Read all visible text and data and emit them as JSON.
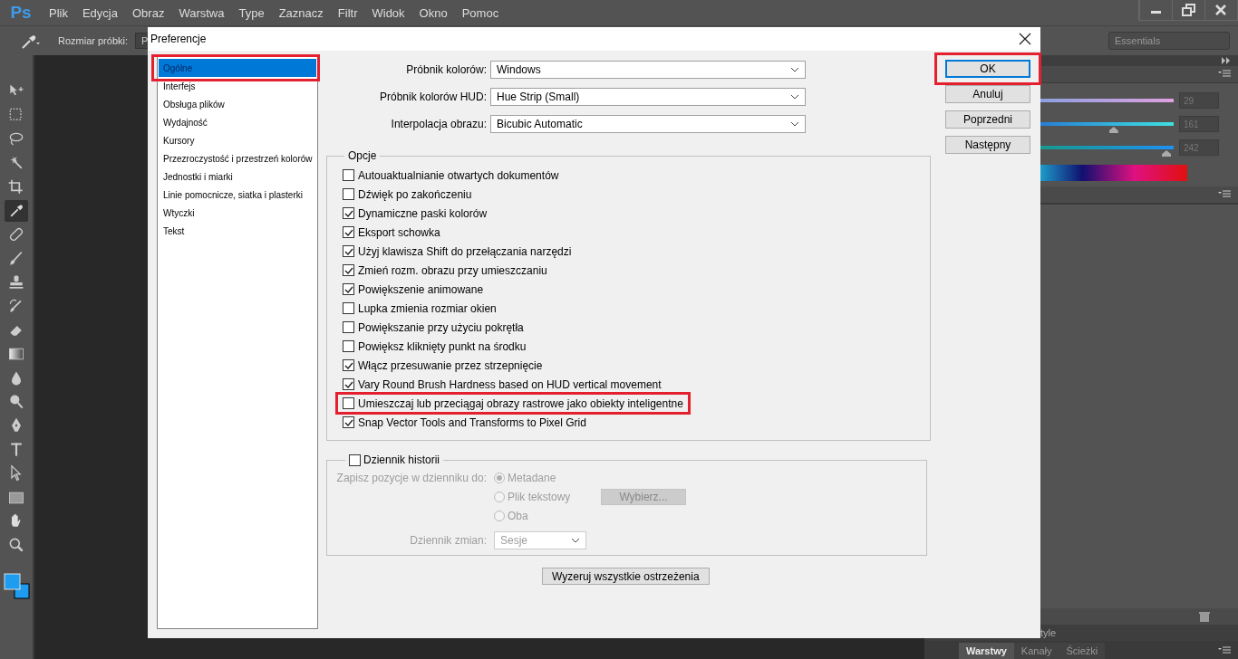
{
  "app": {
    "logo": "Ps",
    "menu": [
      "Plik",
      "Edycja",
      "Obraz",
      "Warstwa",
      "Type",
      "Zaznacz",
      "Filtr",
      "Widok",
      "Okno",
      "Pomoc"
    ]
  },
  "options_bar": {
    "label": "Rozmiar próbki:",
    "value": "P",
    "workspace": "Essentials"
  },
  "tools": [
    {
      "kind": "move",
      "selected": false
    },
    {
      "kind": "marquee",
      "selected": false
    },
    {
      "kind": "lasso",
      "selected": false
    },
    {
      "kind": "wand",
      "selected": false
    },
    {
      "kind": "crop",
      "selected": false
    },
    {
      "kind": "eyedropper",
      "selected": true
    },
    {
      "kind": "healing",
      "selected": false
    },
    {
      "kind": "brush",
      "selected": false
    },
    {
      "kind": "stamp",
      "selected": false
    },
    {
      "kind": "history",
      "selected": false
    },
    {
      "kind": "eraser",
      "selected": false
    },
    {
      "kind": "gradient",
      "selected": false
    },
    {
      "kind": "blur",
      "selected": false
    },
    {
      "kind": "dodge",
      "selected": false
    },
    {
      "kind": "pen",
      "selected": false
    },
    {
      "kind": "type",
      "selected": false
    },
    {
      "kind": "select",
      "selected": false
    },
    {
      "kind": "shape",
      "selected": false
    },
    {
      "kind": "hand",
      "selected": false
    },
    {
      "kind": "zoom",
      "selected": false
    }
  ],
  "color_panel": {
    "sliders": [
      {
        "reading": "29"
      },
      {
        "level": 0.75,
        "reading": "161"
      },
      {
        "level": 0.97,
        "reading": "242"
      }
    ]
  },
  "styles_tab": "tyle",
  "layers_tabs": [
    {
      "label": "Warstwy",
      "selected": true
    },
    {
      "label": "Kanały",
      "selected": false
    },
    {
      "label": "Ścieżki",
      "selected": false
    }
  ],
  "dialog": {
    "title": "Preferencje",
    "categories": [
      {
        "label": "Ogólne",
        "selected": true,
        "highlighted": true
      },
      {
        "label": "Interfejs",
        "selected": false,
        "highlighted": false
      },
      {
        "label": "Obsługa plików",
        "selected": false,
        "highlighted": false
      },
      {
        "label": "Wydajność",
        "selected": false,
        "highlighted": false
      },
      {
        "label": "Kursory",
        "selected": false,
        "highlighted": false
      },
      {
        "label": "Przezroczystość i przestrzeń kolorów",
        "selected": false,
        "highlighted": false
      },
      {
        "label": "Jednostki i miarki",
        "selected": false,
        "highlighted": false
      },
      {
        "label": "Linie pomocnicze, siatka i plasterki",
        "selected": false,
        "highlighted": false
      },
      {
        "label": "Wtyczki",
        "selected": false,
        "highlighted": false
      },
      {
        "label": "Tekst",
        "selected": false,
        "highlighted": false
      }
    ],
    "dropdowns": [
      {
        "label": "Próbnik kolorów:",
        "value": "Windows"
      },
      {
        "label": "Próbnik kolorów HUD:",
        "value": "Hue Strip (Small)"
      },
      {
        "label": "Interpolacja obrazu:",
        "value": "Bicubic Automatic"
      }
    ],
    "options_title": "Opcje",
    "options": [
      {
        "label": "Autouaktualnianie otwartych dokumentów",
        "checked": false,
        "highlighted": false
      },
      {
        "label": "Dźwięk po zakończeniu",
        "checked": false,
        "highlighted": false
      },
      {
        "label": "Dynamiczne paski kolorów",
        "checked": true,
        "highlighted": false
      },
      {
        "label": "Eksport schowka",
        "checked": true,
        "highlighted": false
      },
      {
        "label": "Użyj klawisza Shift do przełączania narzędzi",
        "checked": true,
        "highlighted": false
      },
      {
        "label": "Zmień rozm. obrazu przy umieszczaniu",
        "checked": true,
        "highlighted": false
      },
      {
        "label": "Powiększenie animowane",
        "checked": true,
        "highlighted": false
      },
      {
        "label": "Lupka zmienia rozmiar okien",
        "checked": false,
        "highlighted": false
      },
      {
        "label": "Powiększanie przy użyciu pokrętła",
        "checked": false,
        "highlighted": false
      },
      {
        "label": "Powiększ kliknięty punkt na środku",
        "checked": false,
        "highlighted": false
      },
      {
        "label": "Włącz przesuwanie przez strzepnięcie",
        "checked": true,
        "highlighted": false
      },
      {
        "label": "Vary Round Brush Hardness based on HUD vertical movement",
        "checked": true,
        "highlighted": false
      },
      {
        "label": "Umieszczaj lub przeciągaj obrazy rastrowe jako obiekty inteligentne",
        "checked": false,
        "highlighted": true
      },
      {
        "label": "Snap Vector Tools and Transforms to Pixel Grid",
        "checked": true,
        "highlighted": false
      }
    ],
    "history": {
      "label": "Dziennik historii",
      "checked": false,
      "save_label": "Zapisz pozycje w dzienniku do:",
      "radios": [
        {
          "label": "Metadane",
          "selected": true
        },
        {
          "label": "Plik tekstowy",
          "selected": false
        },
        {
          "label": "Oba",
          "selected": false
        }
      ],
      "choose_button": "Wybierz...",
      "edit_label": "Dziennik zmian:",
      "edit_value": "Sesje",
      "disabled": true
    },
    "reset_button": "Wyzeruj wszystkie ostrzeżenia",
    "buttons": [
      {
        "label": "OK",
        "default": true,
        "highlighted": true
      },
      {
        "label": "Anuluj",
        "default": false,
        "highlighted": false
      },
      {
        "label": "Poprzedni",
        "default": false,
        "highlighted": false
      },
      {
        "label": "Następny",
        "default": false,
        "highlighted": false
      }
    ]
  }
}
